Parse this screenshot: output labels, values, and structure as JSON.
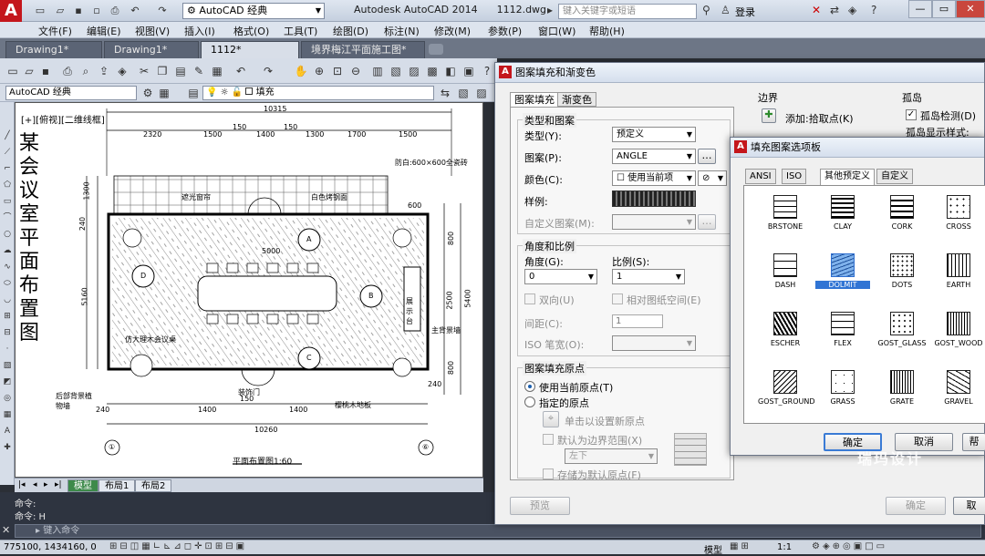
{
  "app": {
    "logo": "A",
    "workspace": "AutoCAD 经典",
    "title": "Autodesk AutoCAD 2014",
    "filename": "1112.dwg",
    "search_placeholder": "键入关键字或短语",
    "login": "登录"
  },
  "menu": [
    "文件(F)",
    "编辑(E)",
    "视图(V)",
    "插入(I)",
    "格式(O)",
    "工具(T)",
    "绘图(D)",
    "标注(N)",
    "修改(M)",
    "参数(P)",
    "窗口(W)",
    "帮助(H)"
  ],
  "file_tabs": [
    {
      "label": "Drawing1*"
    },
    {
      "label": "Drawing1*"
    },
    {
      "label": "1112*"
    },
    {
      "label": "境界梅江平面施工图*"
    }
  ],
  "toolbar2": {
    "workspace": "AutoCAD 经典",
    "layer": "填充"
  },
  "viewport": {
    "label": "[+][俯视][二维线框]",
    "vertical_title": [
      "某",
      "会",
      "议",
      "室",
      "平",
      "面",
      "布",
      "置",
      "图"
    ],
    "dims_top": [
      "10315",
      "2320",
      "1500",
      "150",
      "1400",
      "150",
      "1300",
      "1700",
      "1500"
    ],
    "dims_left": [
      "1300",
      "240",
      "5160"
    ],
    "dims_right": [
      "600",
      "800",
      "2500",
      "5400",
      "800",
      "240"
    ],
    "dims_bottom": [
      "240",
      "1400",
      "150",
      "1400",
      "10260"
    ],
    "dim_center": "5000",
    "notes": {
      "tile": "防白:600×600全瓷砖",
      "curtain": "遮光窗帘",
      "steel": "白色烤钢面",
      "table": "仿大理木会议桌",
      "plant": "后部背景植物墙",
      "scene": "主背景墙",
      "door": "装饰门",
      "floor": "樱桃木地板",
      "display": "展示台",
      "caption": "平面布置图1:60"
    },
    "markers": [
      "A",
      "B",
      "C",
      "D"
    ],
    "axes": [
      "①",
      "⑥"
    ]
  },
  "layout_tabs": [
    "模型",
    "布局1",
    "布局2"
  ],
  "command": {
    "line1": "命令:",
    "line2": "命令: H",
    "prompt": "键入命令"
  },
  "status": {
    "coords": "775100, 1434160, 0",
    "model": "模型",
    "scale": "1:1"
  },
  "hatch_dialog": {
    "title": "图案填充和渐变色",
    "tabs": [
      "图案填充",
      "渐变色"
    ],
    "type_pattern_group": "类型和图案",
    "type_label": "类型(Y):",
    "type_value": "预定义",
    "pattern_label": "图案(P):",
    "pattern_value": "ANGLE",
    "color_label": "颜色(C):",
    "color_value": "使用当前项",
    "swatch_label": "样例:",
    "custom_label": "自定义图案(M):",
    "angle_scale_group": "角度和比例",
    "angle_label": "角度(G):",
    "angle_value": "0",
    "scale_label": "比例(S):",
    "scale_value": "1",
    "double_label": "双向(U)",
    "relative_label": "相对图纸空间(E)",
    "spacing_label": "间距(C):",
    "spacing_value": "1",
    "iso_label": "ISO 笔宽(O):",
    "origin_group": "图案填充原点",
    "origin_current": "使用当前原点(T)",
    "origin_specified": "指定的原点",
    "origin_click": "单击以设置新原点",
    "origin_default": "默认为边界范围(X)",
    "origin_position": "左下",
    "origin_store": "存储为默认原点(F)",
    "boundary_group": "边界",
    "boundary_add": "添加:拾取点(K)",
    "island_group": "孤岛",
    "island_detect": "孤岛检测(D)",
    "island_style": "孤岛显示样式:",
    "preview": "预览",
    "ok": "确定",
    "cancel": "取"
  },
  "palette": {
    "title": "填充图案选项板",
    "tabs": [
      "ANSI",
      "ISO",
      "其他预定义",
      "自定义"
    ],
    "patterns": [
      {
        "name": "BRSTONE",
        "selected": false
      },
      {
        "name": "CLAY",
        "selected": false
      },
      {
        "name": "CORK",
        "selected": false
      },
      {
        "name": "CROSS",
        "selected": false
      },
      {
        "name": "DASH",
        "selected": false
      },
      {
        "name": "DOLMIT",
        "selected": true
      },
      {
        "name": "DOTS",
        "selected": false
      },
      {
        "name": "EARTH",
        "selected": false
      },
      {
        "name": "ESCHER",
        "selected": false
      },
      {
        "name": "FLEX",
        "selected": false
      },
      {
        "name": "GOST_GLASS",
        "selected": false
      },
      {
        "name": "GOST_WOOD",
        "selected": false
      },
      {
        "name": "GOST_GROUND",
        "selected": false
      },
      {
        "name": "GRASS",
        "selected": false
      },
      {
        "name": "GRATE",
        "selected": false
      },
      {
        "name": "GRAVEL",
        "selected": false
      }
    ],
    "ok": "确定",
    "cancel": "取消",
    "help": "帮"
  },
  "watermark": "瑞玛设计",
  "colors": {
    "accent": "#3074d4",
    "logo": "#c4161c",
    "active_tab": "#3d8a4a"
  }
}
